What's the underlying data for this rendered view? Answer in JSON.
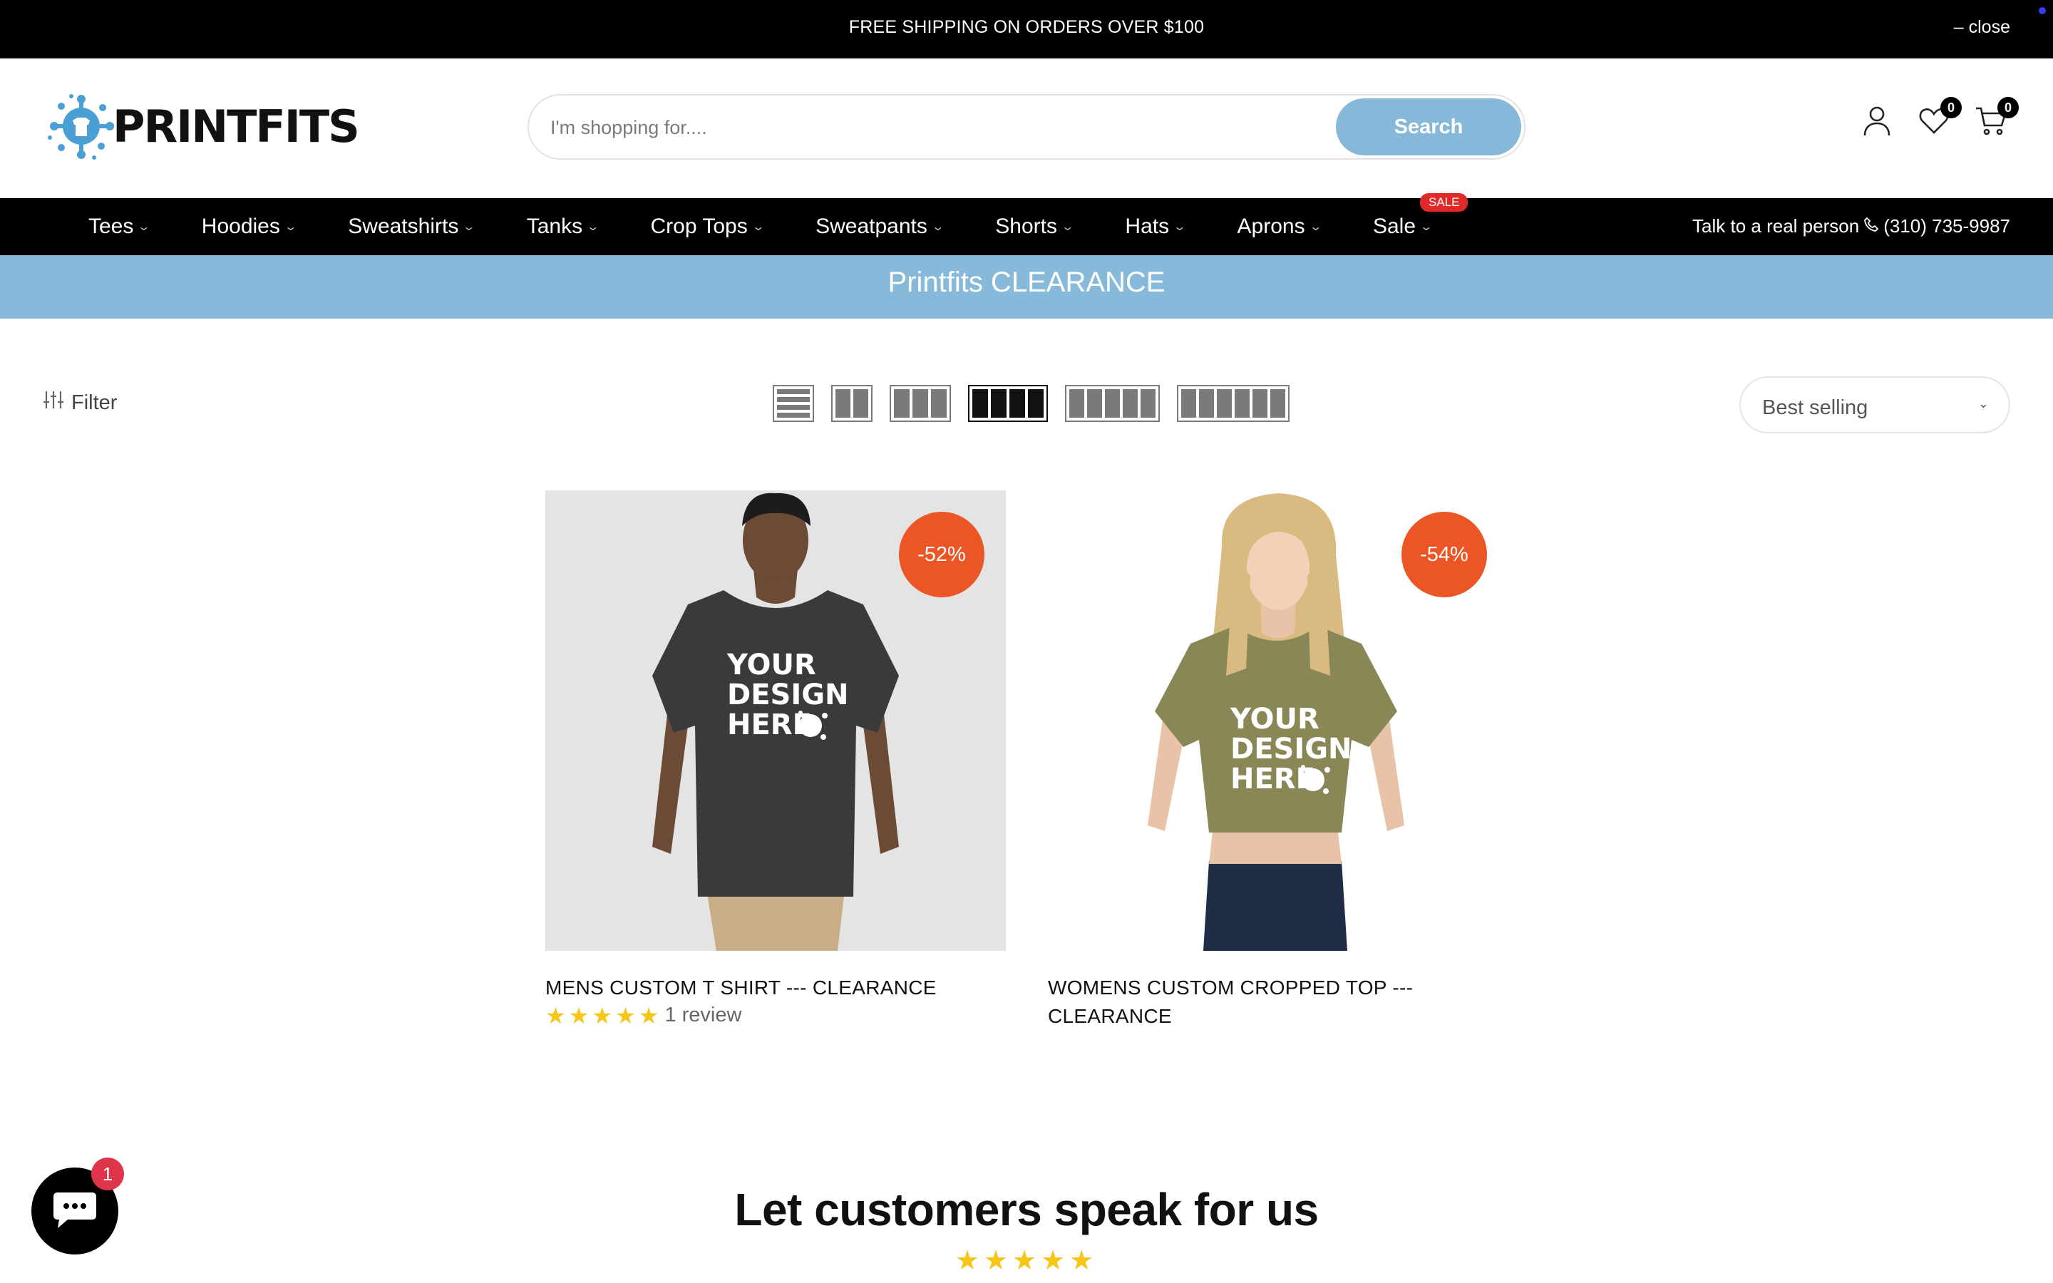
{
  "announcement": {
    "text": "FREE SHIPPING ON ORDERS OVER $100",
    "close_label": "– close"
  },
  "header": {
    "logo_text": "PRINTFITS",
    "search": {
      "placeholder": "I'm shopping for....",
      "button_label": "Search"
    },
    "wishlist_count": "0",
    "cart_count": "0"
  },
  "nav": {
    "items": [
      {
        "label": "Tees"
      },
      {
        "label": "Hoodies"
      },
      {
        "label": "Sweatshirts"
      },
      {
        "label": "Tanks"
      },
      {
        "label": "Crop Tops"
      },
      {
        "label": "Sweatpants"
      },
      {
        "label": "Shorts"
      },
      {
        "label": "Hats"
      },
      {
        "label": "Aprons"
      },
      {
        "label": "Sale",
        "badge": "SALE"
      }
    ],
    "phone_label": "Talk to a real person",
    "phone_number": "(310) 735-9987"
  },
  "collection": {
    "title": "Printfits CLEARANCE"
  },
  "toolbar": {
    "filter_label": "Filter",
    "sort_value": "Best selling",
    "active_layout": 4
  },
  "products": [
    {
      "title": "MENS CUSTOM T SHIRT --- CLEARANCE",
      "discount": "-52%",
      "rating": 5,
      "reviews": "1 review",
      "shirt_color": "#3a3a3c",
      "print_text": [
        "YOUR",
        "DESIGN",
        "HERE"
      ]
    },
    {
      "title": "WOMENS CUSTOM CROPPED TOP --- CLEARANCE",
      "discount": "-54%",
      "shirt_color": "#8a8757",
      "print_text": [
        "YOUR",
        "DESIGN",
        "HERE"
      ]
    }
  ],
  "testimonials": {
    "heading": "Let customers speak for us",
    "stars": "★★★★★"
  },
  "chat": {
    "unread": "1"
  },
  "colors": {
    "accent": "#87b9da",
    "badge": "#ec5626",
    "star": "#f5c518",
    "sale": "#e02a2a"
  }
}
